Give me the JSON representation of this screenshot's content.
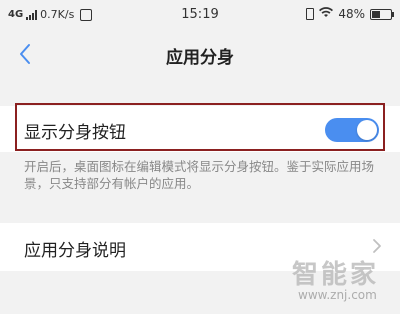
{
  "status_bar": {
    "network": "4G",
    "speed": "0.7K/s",
    "time": "15:19",
    "battery_percent": "48%",
    "battery_level": 0.48,
    "icons": [
      "signal-icon",
      "message-icon",
      "vibrate-icon",
      "wifi-icon",
      "battery-icon"
    ]
  },
  "header": {
    "back_icon": "chevron-left-icon",
    "title": "应用分身"
  },
  "settings": {
    "show_clone_button": {
      "label": "显示分身按钮",
      "enabled": true
    },
    "description": "开启后，桌面图标在编辑模式将显示分身按钮。鉴于实际应用场景，只支持部分有帐户的应用。",
    "clone_info": {
      "label": "应用分身说明",
      "icon": "chevron-right-icon"
    }
  },
  "watermark": {
    "logo": "智能家",
    "url": "www.znj.com"
  },
  "colors": {
    "accent": "#4a8ef0",
    "highlight_border": "#8b2020",
    "background": "#f2f2f2"
  }
}
